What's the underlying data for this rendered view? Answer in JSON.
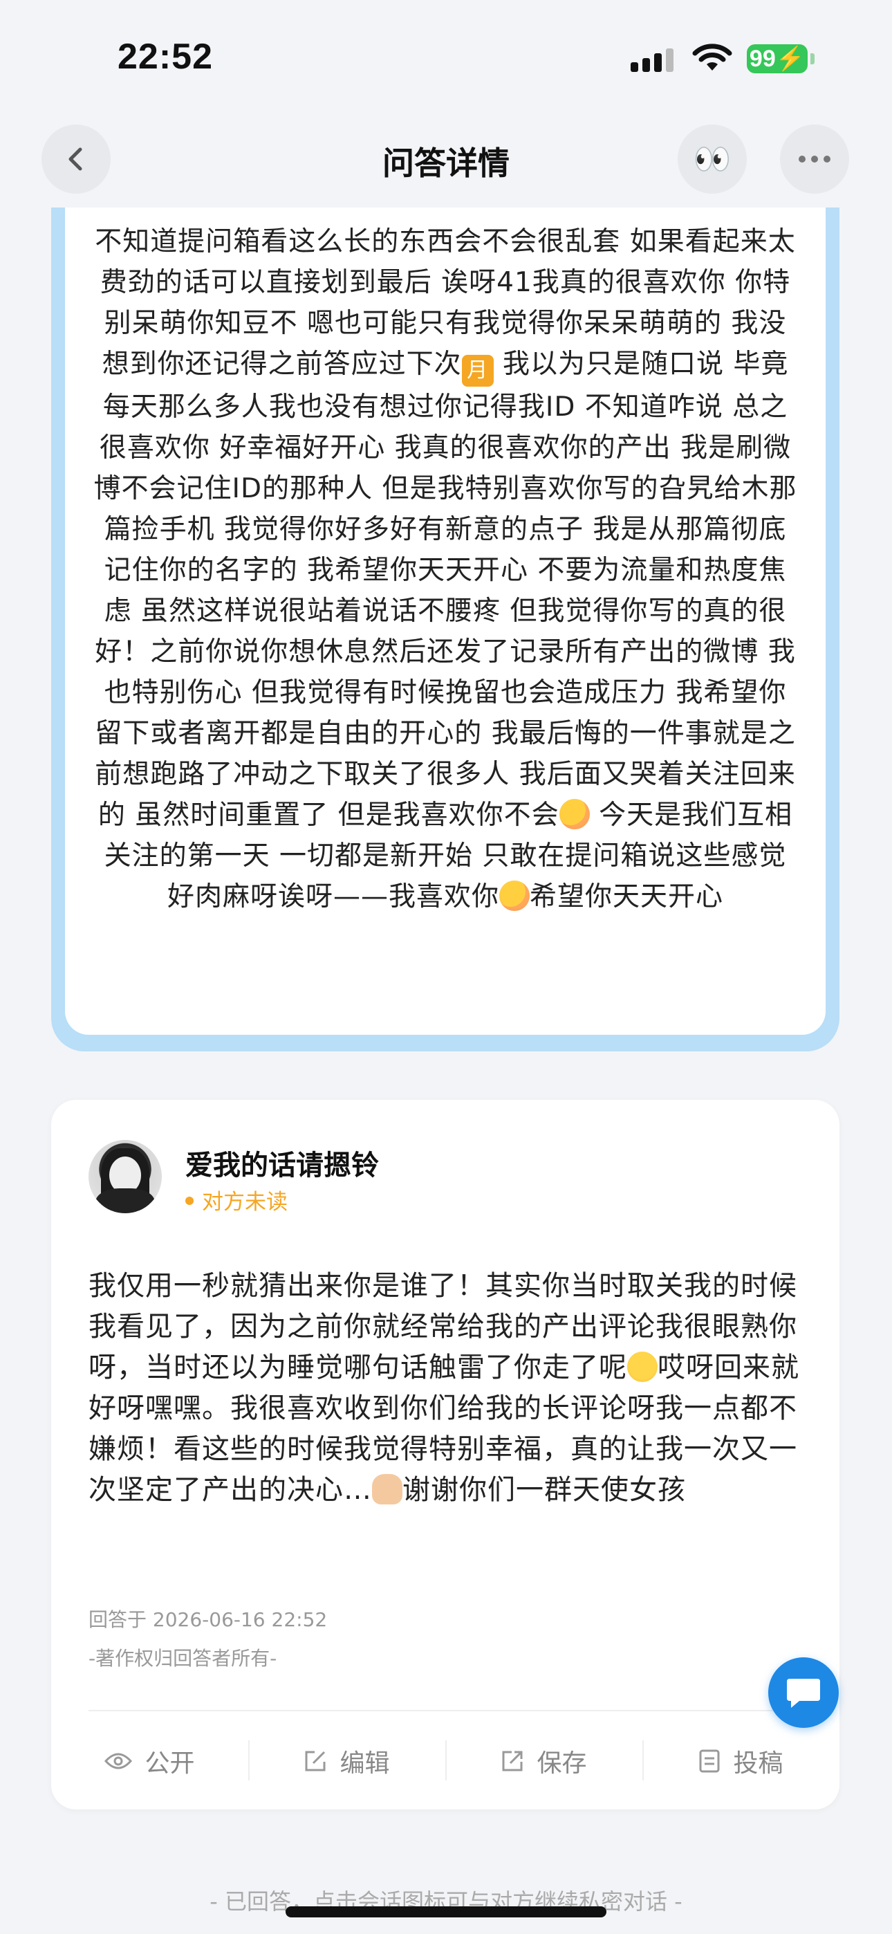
{
  "status_bar": {
    "time": "22:52",
    "battery": "99"
  },
  "nav": {
    "title": "问答详情",
    "eyes_icon": "👀"
  },
  "question": {
    "text": "不知道提问箱看这么长的东西会不会很乱套 如果看起来太费劲的话可以直接划到最后 诶呀41我真的很喜欢你 你特别呆萌你知豆不 嗯也可能只有我觉得你呆呆萌萌的 我没想到你还记得之前答应过下次",
    "moon": "月",
    "text2": " 我以为只是随口说 毕竟每天那么多人我也没有想过你记得我ID 不知道咋说 总之很喜欢你 好幸福好开心 我真的很喜欢你的产出 我是刷微博不会记住ID的那种人 但是我特别喜欢你写的旮旯给木那篇捡手机 我觉得你好多好有新意的点子 我是从那篇彻底记住你的名字的 我希望你天天开心 不要为流量和热度焦虑 虽然这样说很站着说话不腰疼 但我觉得你写的真的很好！之前你说你想休息然后还发了记录所有产出的微博 我也特别伤心 但我觉得有时候挽留也会造成压力 我希望你留下或者离开都是自由的开心的 我最后悔的一件事就是之前想跑路了冲动之下取关了很多人 我后面又哭着关注回来的 虽然时间重置了 但是我喜欢你不会",
    "text3": "今天是我们互相关注的第一天 一切都是新开始 只敢在提问箱说这些感觉好肉麻呀诶呀——我喜欢你",
    "text4": "希望你天天开心"
  },
  "answer": {
    "username": "爱我的话请摁铃",
    "read_status": "对方未读",
    "text1": "我仅用一秒就猜出来你是谁了！其实你当时取关我的时候我看见了，因为之前你就经常给我的产出评论我很眼熟你呀，当时还以为睡觉哪句话触雷了你走了呢",
    "text2": "哎呀回来就好呀嘿嘿。我很喜欢收到你们给我的长评论呀我一点都不嫌烦！看这些的时候我觉得特别幸福，真的让我一次又一次坚定了产出的决心…",
    "text3": "谢谢你们一群天使女孩",
    "time": "回答于 2026-06-16 22:52",
    "copyright": "-著作权归回答者所有-"
  },
  "actions": [
    {
      "label": "公开",
      "icon": "eye-icon"
    },
    {
      "label": "编辑",
      "icon": "edit-icon"
    },
    {
      "label": "保存",
      "icon": "share-icon"
    },
    {
      "label": "投稿",
      "icon": "document-icon"
    }
  ],
  "footer": {
    "note": "- 已回答，点击会话图标可与对方继续私密对话 -"
  }
}
